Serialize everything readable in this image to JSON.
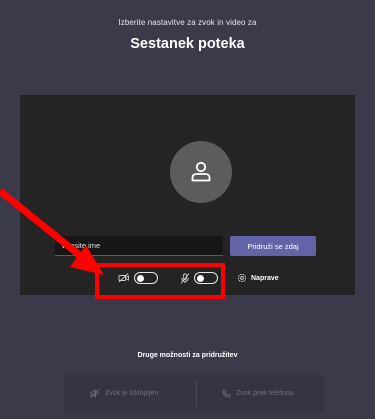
{
  "header": {
    "subtitle": "Izberite nastavitve za zvok in video za",
    "title": "Sestanek poteka"
  },
  "preview": {
    "avatar_icon": "person-icon",
    "name_placeholder": "Vnesite ime",
    "join_label": "Pridruži se zdaj"
  },
  "controls": {
    "camera": {
      "icon": "camera-off-icon",
      "on": false
    },
    "microphone": {
      "icon": "mic-off-icon",
      "on": false
    },
    "devices_label": "Naprave",
    "devices_icon": "gear-icon"
  },
  "annotation": {
    "color": "#ff0000"
  },
  "other_options": {
    "title": "Druge možnosti za pridružitev",
    "audio_off_label": "Zvok je izklopljen",
    "phone_audio_label": "Zvok prek telefona"
  },
  "colors": {
    "background": "#3b3a4a",
    "preview": "#242424",
    "accent": "#6264a7"
  }
}
